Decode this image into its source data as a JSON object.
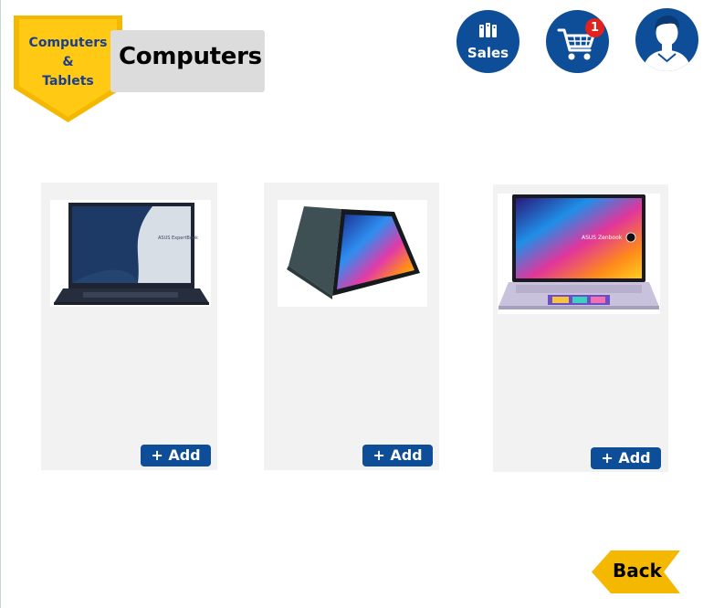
{
  "category": {
    "badge_label": "Computers\n&\nTablets",
    "title": "Computers"
  },
  "header": {
    "sales_label": "Sales",
    "cart_count": "1"
  },
  "products": [
    {
      "add_label": "+ Add",
      "screen_text": "ASUS ExpertBook"
    },
    {
      "add_label": "+ Add",
      "screen_text": ""
    },
    {
      "add_label": "+ Add",
      "screen_text": "ASUS Zenbook"
    }
  ],
  "footer": {
    "back_label": "Back"
  },
  "colors": {
    "primary_blue": "#0e4d97",
    "badge_yellow": "#f5b800",
    "title_plate_gray": "#dcdcdc",
    "card_gray": "#f2f2f2",
    "cart_badge_red": "#e0231f"
  }
}
